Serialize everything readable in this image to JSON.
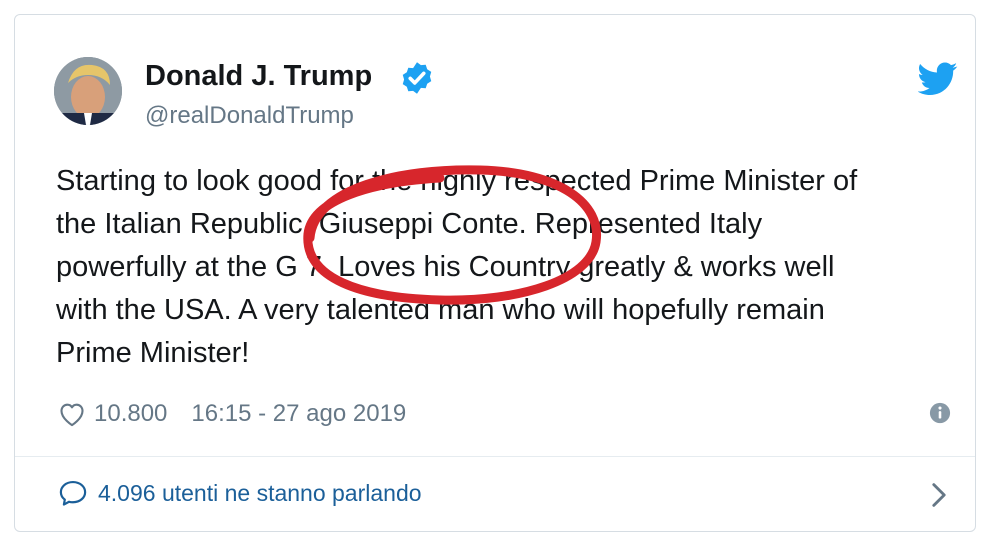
{
  "tweet": {
    "display_name": "Donald J. Trump",
    "handle": "@realDonaldTrump",
    "text_lines": [
      "Starting to look good for the highly respected Prime Minister of",
      "the Italian Republic, Giuseppi Conte. Represented Italy",
      "powerfully at the G 7. Loves his Country greatly & works well",
      "with the USA. A very talented man who will hopefully remain",
      "Prime Minister!"
    ],
    "likes": "10.800",
    "timestamp": "16:15 - 27 ago 2019",
    "conversation": "4.096 utenti ne stanno parlando"
  },
  "icons": {
    "verified": "verified-badge-icon",
    "brand": "twitter-bird-icon",
    "like": "heart-icon",
    "info": "info-icon",
    "reply": "speech-bubble-icon",
    "more": "chevron-right-icon"
  },
  "colors": {
    "verified_blue": "#1da1f2",
    "annotation_red": "#d7262c",
    "link_blue": "#1b5f99",
    "muted_gray": "#657786"
  }
}
